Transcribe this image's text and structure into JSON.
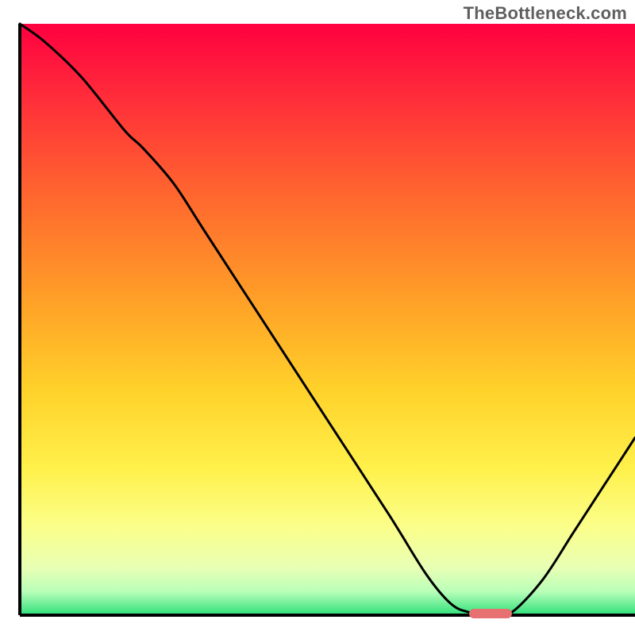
{
  "watermark": "TheBottleneck.com",
  "chart_data": {
    "type": "line",
    "title": "",
    "xlabel": "",
    "ylabel": "",
    "xlim": [
      0,
      100
    ],
    "ylim": [
      0,
      100
    ],
    "grid": false,
    "legend": false,
    "gradient_stops": [
      {
        "pct": 0,
        "color": "#ff0040"
      },
      {
        "pct": 12,
        "color": "#ff2b3a"
      },
      {
        "pct": 30,
        "color": "#ff6a2e"
      },
      {
        "pct": 48,
        "color": "#ffa427"
      },
      {
        "pct": 62,
        "color": "#ffd22a"
      },
      {
        "pct": 75,
        "color": "#fff04a"
      },
      {
        "pct": 85,
        "color": "#fbff8a"
      },
      {
        "pct": 92,
        "color": "#e8ffb4"
      },
      {
        "pct": 96,
        "color": "#b9ffb9"
      },
      {
        "pct": 100,
        "color": "#2ee07a"
      }
    ],
    "series": [
      {
        "name": "curve",
        "color": "#000000",
        "x": [
          0,
          4,
          10,
          17,
          20,
          25,
          30,
          40,
          50,
          60,
          66,
          70,
          73,
          77,
          80,
          85,
          90,
          95,
          100
        ],
        "y": [
          100,
          97,
          91,
          82,
          79,
          73,
          65,
          49,
          33,
          17,
          7,
          2,
          0.5,
          0,
          0.5,
          6,
          14,
          22,
          30
        ]
      }
    ],
    "marker": {
      "x_start": 73,
      "x_end": 80,
      "y": 0,
      "color": "#e77070"
    },
    "axes_color": "#000000"
  }
}
